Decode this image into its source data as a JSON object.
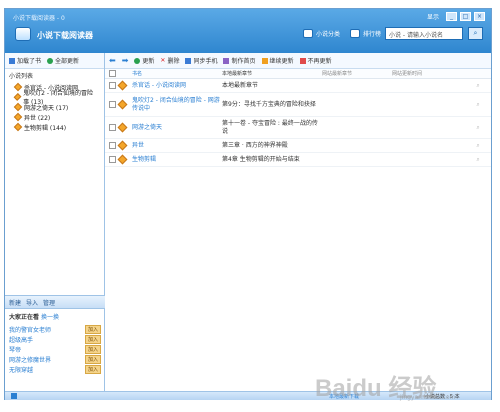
{
  "window": {
    "title": "小说下载阅读器 - 0",
    "brand": "小说下载阅读器"
  },
  "window_controls": {
    "menu_label": "显示",
    "min": "_",
    "max": "□",
    "close": "×"
  },
  "top_nav": [
    {
      "label": "小说分类"
    },
    {
      "label": "排行榜"
    }
  ],
  "search": {
    "value": "小说 - 请输入小说名",
    "button": "⌕"
  },
  "sidebar": {
    "toolbar": {
      "add": "加载了书",
      "update_all": "全部更新"
    },
    "novels_header": "小说列表",
    "novels": [
      {
        "label": "杀官话 - 小说阅读网"
      },
      {
        "label": "鬼吹灯2 - 闭合仙境的冒险事 (13)"
      },
      {
        "label": "网游之倚天 (17)"
      },
      {
        "label": "异世 (22)"
      },
      {
        "label": "生物剪辑 (144)"
      }
    ],
    "bottom_bar": {
      "new": "新建",
      "import": "导入",
      "manage": "管理"
    },
    "reading_header": "大家正在看",
    "reading_header_link": "换一换",
    "reading": [
      {
        "title": "我的警官女老师",
        "tag": "加入"
      },
      {
        "title": "超级高手",
        "tag": "加入"
      },
      {
        "title": "琴帝",
        "tag": "加入"
      },
      {
        "title": "网游之修魔世界",
        "tag": "加入"
      },
      {
        "title": "无限穿越",
        "tag": "加入"
      }
    ]
  },
  "toolbar": {
    "back": "⬅",
    "forward": "➡",
    "refresh": "更新",
    "delete": "删除",
    "sync_phone": "同步手机",
    "local_home": "制作首页",
    "continue_update": "继续更新",
    "no_update": "不再更新"
  },
  "table": {
    "columns": [
      "书名",
      "本地最新章节",
      "网站最新章节",
      "网站更新时间"
    ],
    "rows": [
      {
        "name": "杀官话 - 小说阅读网",
        "local": "本地最新章节"
      },
      {
        "name": "鬼吹灯2 - 闭合仙境的冒险 - 网游传说中",
        "local": "第9分：寻找千方宝典的冒险和抉择"
      },
      {
        "name": "网游之倚天",
        "local": "第十一卷 - 夺宝冒险 : 最终一战的传说"
      },
      {
        "name": "异世",
        "local": "第三章 · 西方的神界神殿"
      },
      {
        "name": "生物剪辑",
        "local": "第4章 生物剪辑的开始与结束"
      }
    ],
    "action_icon": "⌕"
  },
  "status": {
    "middle": "本地最新下载",
    "right": "小说总数 : 5 本"
  },
  "watermark": {
    "main": "Baidu 经验",
    "sub": "jingyan.baidu.com"
  }
}
